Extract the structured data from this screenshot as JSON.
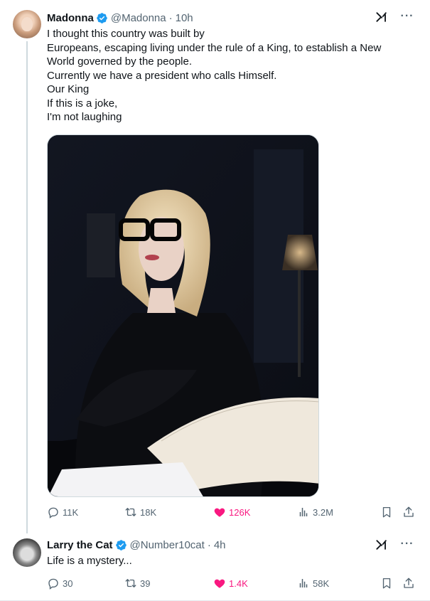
{
  "colors": {
    "verified": "#1d9bf0",
    "like_active": "#f91880",
    "muted": "#536471",
    "text": "#0f1419"
  },
  "tweets": [
    {
      "author_name": "Madonna",
      "handle": "@Madonna",
      "separator": "·",
      "time": "10h",
      "text": "I thought this country was built by\nEuropeans, escaping living under the rule of a King, to establish a New World governed by the people.\nCurrently we have a president who calls Himself.\nOur King\nIf this is a joke,\nI'm not laughing",
      "replies": "11K",
      "reposts": "18K",
      "likes": "126K",
      "views": "3.2M",
      "liked": true
    },
    {
      "author_name": "Larry the Cat",
      "handle": "@Number10cat",
      "separator": "·",
      "time": "4h",
      "text": "Life is a mystery...",
      "replies": "30",
      "reposts": "39",
      "likes": "1.4K",
      "views": "58K",
      "liked": true
    }
  ],
  "icons": {
    "verified": "verified-badge-icon",
    "grok": "grok-icon",
    "more": "more-icon",
    "reply": "reply-icon",
    "repost": "repost-icon",
    "like": "heart-icon",
    "views": "views-icon",
    "bookmark": "bookmark-icon",
    "share": "share-icon"
  }
}
